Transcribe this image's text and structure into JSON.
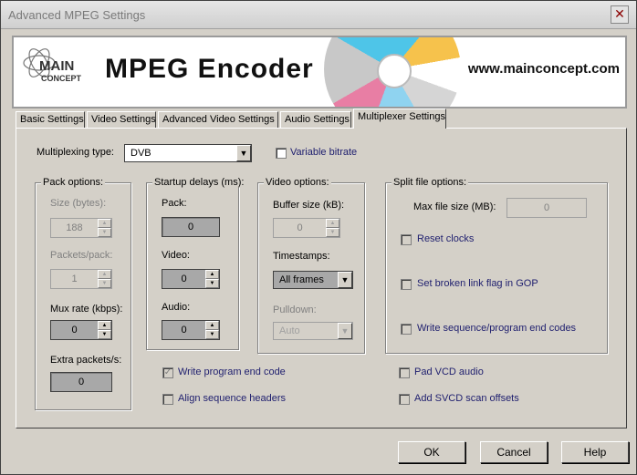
{
  "window": {
    "title": "Advanced MPEG Settings",
    "close_glyph": "✕"
  },
  "banner": {
    "logo_main": "MAIN",
    "logo_sub": "CONCEPT",
    "product": "MPEG Encoder",
    "website": "www.mainconcept.com"
  },
  "tabs": [
    {
      "label": "Basic Settings"
    },
    {
      "label": "Video Settings"
    },
    {
      "label": "Advanced Video Settings"
    },
    {
      "label": "Audio Settings"
    },
    {
      "label": "Multiplexer Settings",
      "active": true
    }
  ],
  "mux": {
    "type_label": "Multiplexing type:",
    "type_value": "DVB",
    "variable_bitrate_label": "Variable bitrate",
    "variable_bitrate_checked": false
  },
  "pack": {
    "title": "Pack options:",
    "size_label": "Size (bytes):",
    "size_value": "188",
    "packets_label": "Packets/pack:",
    "packets_value": "1",
    "muxrate_label": "Mux rate (kbps):",
    "muxrate_value": "0",
    "extra_label": "Extra packets/s:",
    "extra_value": "0"
  },
  "startup": {
    "title": "Startup delays (ms):",
    "pack_label": "Pack:",
    "pack_value": "0",
    "video_label": "Video:",
    "video_value": "0",
    "audio_label": "Audio:",
    "audio_value": "0"
  },
  "video": {
    "title": "Video options:",
    "buffer_label": "Buffer size (kB):",
    "buffer_value": "0",
    "timestamps_label": "Timestamps:",
    "timestamps_value": "All frames",
    "pulldown_label": "Pulldown:",
    "pulldown_value": "Auto"
  },
  "split": {
    "title": "Split file options:",
    "maxsize_label": "Max file size (MB):",
    "maxsize_value": "0",
    "reset_clocks_label": "Reset clocks",
    "broken_link_label": "Set broken link flag in GOP",
    "write_seq_label": "Write sequence/program end codes"
  },
  "checks": {
    "write_program_end_label": "Write program end code",
    "write_program_end_checked": true,
    "align_seq_label": "Align sequence headers",
    "pad_vcd_label": "Pad VCD audio",
    "add_svcd_label": "Add SVCD scan offsets"
  },
  "buttons": {
    "ok": "OK",
    "cancel": "Cancel",
    "help": "Help"
  }
}
